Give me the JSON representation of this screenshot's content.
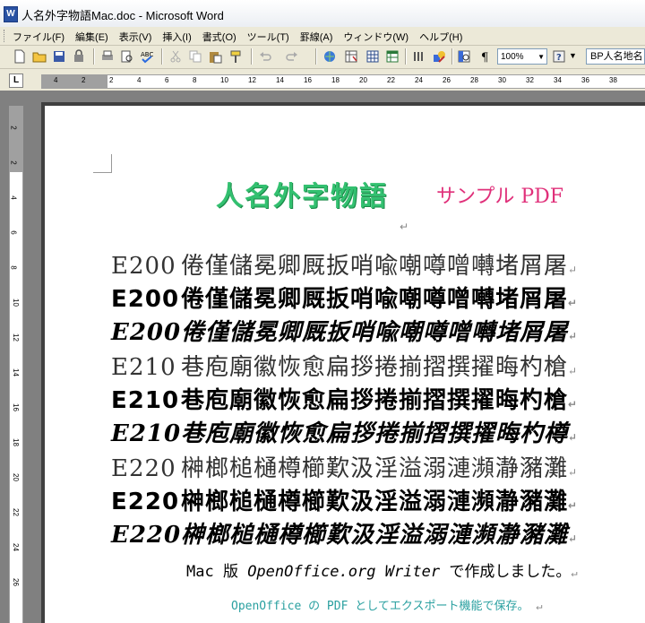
{
  "window": {
    "title": "人名外字物語Mac.doc - Microsoft Word",
    "app_icon": "W"
  },
  "menu": [
    "ファイル(F)",
    "編集(E)",
    "表示(V)",
    "挿入(I)",
    "書式(O)",
    "ツール(T)",
    "罫線(A)",
    "ウィンドウ(W)",
    "ヘルプ(H)"
  ],
  "toolbar": {
    "zoom": "100%",
    "style": "BP人名地名",
    "icons": [
      "new-icon",
      "open-icon",
      "save-icon",
      "permission-icon",
      "print-icon",
      "print-preview-icon",
      "spelling-icon",
      "cut-icon",
      "copy-icon",
      "paste-icon",
      "format-painter-icon",
      "undo-icon",
      "redo-icon",
      "hyperlink-icon",
      "tables-borders-icon",
      "insert-table-icon",
      "insert-excel-icon",
      "columns-icon",
      "drawing-icon",
      "document-map-icon",
      "show-hide-icon",
      "help-icon"
    ]
  },
  "ruler": {
    "tab_selector": "L",
    "h_labels": [
      "4",
      "2",
      "2",
      "4",
      "6",
      "8",
      "10",
      "12",
      "14",
      "16",
      "18",
      "20",
      "22",
      "24",
      "26",
      "28",
      "30",
      "32",
      "34",
      "36",
      "38"
    ],
    "v_labels": [
      "2",
      "2",
      "4",
      "6",
      "8",
      "10",
      "12",
      "14",
      "16",
      "18",
      "20",
      "22",
      "24",
      "26"
    ]
  },
  "document": {
    "title": "人名外字物語",
    "subtitle": "サンプル PDF",
    "para_mark": "↵",
    "rows": [
      {
        "code": "E200",
        "chars": "倦僅儲冕卿厩扳哨喩嘲噂噌囀堵屑屠"
      },
      {
        "code": "E200",
        "chars": "倦僅儲冕卿厩扳哨喩嘲噂噌囀堵屑屠"
      },
      {
        "code": "E200",
        "chars": "倦僅儲冕卿厩扳哨喩嘲噂噌囀堵屑屠"
      },
      {
        "code": "E210",
        "chars": "巷庖廟徽恢愈扁拶捲揃摺撰擢晦杓槍"
      },
      {
        "code": "E210",
        "chars": "巷庖廟徽恢愈扁拶捲揃摺撰擢晦杓槍"
      },
      {
        "code": "E210",
        "chars": "巷庖廟徽恢愈扁拶捲揃摺撰擢晦杓樽"
      },
      {
        "code": "E220",
        "chars": "榊榔槌樋樽櫛歎汲淫溢溺漣瀕瀞瀦灘"
      },
      {
        "code": "E220",
        "chars": "榊榔槌樋樽櫛歎汲淫溢溺漣瀕瀞瀦灘"
      },
      {
        "code": "E220",
        "chars": "榊榔槌樋樽櫛歎汲淫溢溺漣瀕瀞瀦灘"
      }
    ],
    "note1": {
      "pre": "Mac 版 ",
      "italic": "OpenOffice.org Writer",
      "post": " で作成しました。"
    },
    "note2": "OpenOffice の PDF としてエクスポート機能で保存。"
  }
}
